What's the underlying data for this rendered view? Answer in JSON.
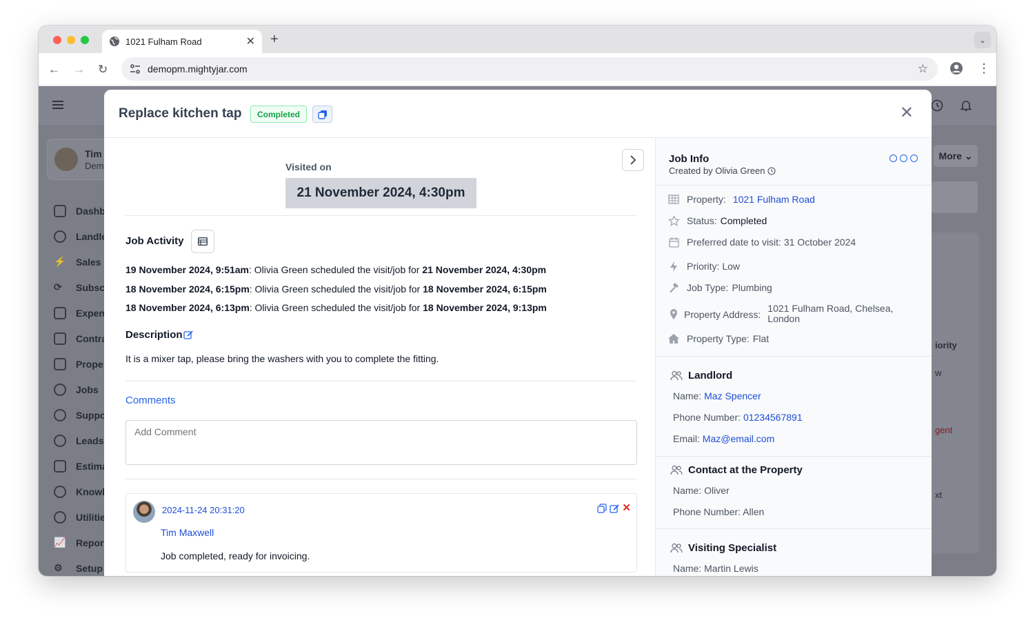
{
  "browser": {
    "tab_title": "1021 Fulham Road",
    "url": "demopm.mightyjar.com"
  },
  "background_app": {
    "user_name": "Tim",
    "user_role": "Dem",
    "nav": [
      "Dashb",
      "Landlo",
      "Sales",
      "Subsc",
      "Expen",
      "Contra",
      "Prope",
      "Jobs",
      "Suppo",
      "Leads",
      "Estima",
      "Knowl",
      "Utilitie",
      "Repor",
      "Setup"
    ],
    "more_button": "More",
    "right_col": {
      "priority": "iority",
      "low": "w",
      "urgent": "gent",
      "next": "xt"
    }
  },
  "modal": {
    "title": "Replace kitchen tap",
    "status": "Completed",
    "visited_label": "Visited on",
    "visited_date": "21 November 2024, 4:30pm",
    "job_activity_title": "Job Activity",
    "activity": [
      {
        "time": "19 November 2024, 9:51am",
        "text": ": Olivia Green scheduled the visit/job for ",
        "target": "21 November 2024, 4:30pm"
      },
      {
        "time": "18 November 2024, 6:15pm",
        "text": ": Olivia Green scheduled the visit/job for ",
        "target": "18 November 2024, 6:15pm"
      },
      {
        "time": "18 November 2024, 6:13pm",
        "text": ": Olivia Green scheduled the visit/job for ",
        "target": "18 November 2024, 9:13pm"
      }
    ],
    "description_title": "Description",
    "description": "It is a mixer tap, please bring the washers with you to complete the fitting.",
    "comments_title": "Comments",
    "comment_placeholder": "Add Comment",
    "comment": {
      "timestamp": "2024-11-24 20:31:20",
      "author": "Tim Maxwell",
      "text": "Job completed, ready for invoicing."
    }
  },
  "job_info": {
    "title": "Job Info",
    "created_by": "Created by Olivia Green",
    "property_label": "Property:",
    "property_value": "1021 Fulham Road",
    "status_label": "Status:",
    "status_value": "Completed",
    "preferred_date": "Preferred date to visit: 31 October 2024",
    "priority": "Priority: Low",
    "job_type_label": "Job Type:",
    "job_type_value": "Plumbing",
    "address_label": "Property Address:",
    "address_line1": "1021 Fulham Road, Chelsea,",
    "address_line2": "London",
    "property_type_label": "Property Type:",
    "property_type_value": "Flat"
  },
  "landlord": {
    "title": "Landlord",
    "name_label": "Name: ",
    "name": "Maz Spencer",
    "phone_label": "Phone Number: ",
    "phone": "01234567891",
    "email_label": "Email: ",
    "email": "Maz@email.com"
  },
  "contact": {
    "title": "Contact at the Property",
    "name": "Name: Oliver",
    "phone": "Phone Number: Allen"
  },
  "specialist": {
    "title": "Visiting Specialist",
    "name": "Name: Martin Lewis"
  }
}
